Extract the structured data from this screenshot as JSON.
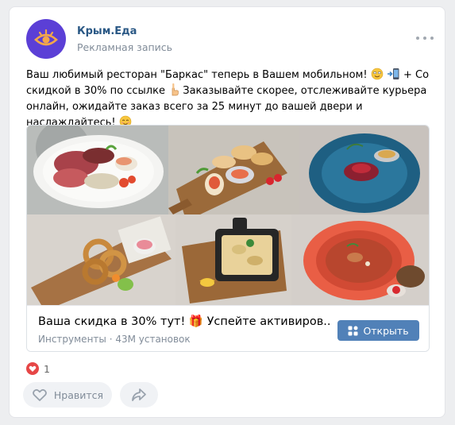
{
  "post": {
    "author": "Крым.Еда",
    "subtitle": "Рекламная запись",
    "text_1": "Ваш любимый ресторан \"Баркас\" теперь в Вашем мобильном!",
    "text_2": "+ Со скидкой в 30% по ссылке",
    "text_3": "Заказывайте скорее, отслеживайте курьера онлайн, ожидайте заказ всего за 25 минут до вашей двери и наслаждайтесь!"
  },
  "attachment": {
    "title": "Ваша скидка в 30% тут! 🎁 Успейте активиров...",
    "subtitle": "Инструменты · 43M установок",
    "button_label": "Открыть"
  },
  "reactions": {
    "like_count": "1"
  },
  "actions": {
    "like_label": "Нравится"
  },
  "colors": {
    "accent": "#5181b8",
    "link": "#2a5885",
    "avatar": "#5b3fd6",
    "heart": "#e64646"
  }
}
